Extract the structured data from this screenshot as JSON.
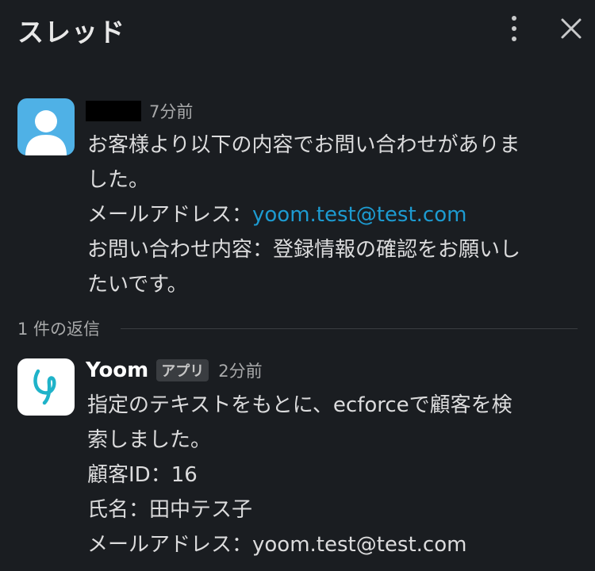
{
  "header": {
    "title": "スレッド",
    "more_icon": "more-vertical-icon",
    "close_icon": "close-icon"
  },
  "thread": {
    "parent": {
      "avatar_icon": "user-avatar-icon",
      "timestamp": "7分前",
      "body": {
        "line1": "お客様より以下の内容でお問い合わせがありま",
        "line2": "した。",
        "email_label": "メールアドレス：",
        "email_link": "yoom.test@test.com",
        "inquiry_line1": "お問い合わせ内容：登録情報の確認をお願いし",
        "inquiry_line2": "たいです。"
      }
    },
    "replies_label": "1 件の返信",
    "reply": {
      "avatar_icon": "yoom-logo-icon",
      "sender": "Yoom",
      "badge": "アプリ",
      "timestamp": "2分前",
      "body": {
        "line1": "指定のテキストをもとに、ecforceで顧客を検",
        "line2": "索しました。",
        "customer_id": "顧客ID：16",
        "name": "氏名：田中テス子",
        "email": "メールアドレス：yoom.test@test.com"
      }
    }
  },
  "colors": {
    "background": "#1a1d21",
    "link": "#1d9bd1",
    "user_avatar": "#4fb1e6",
    "yoom_logo": "#1fb3c9"
  }
}
